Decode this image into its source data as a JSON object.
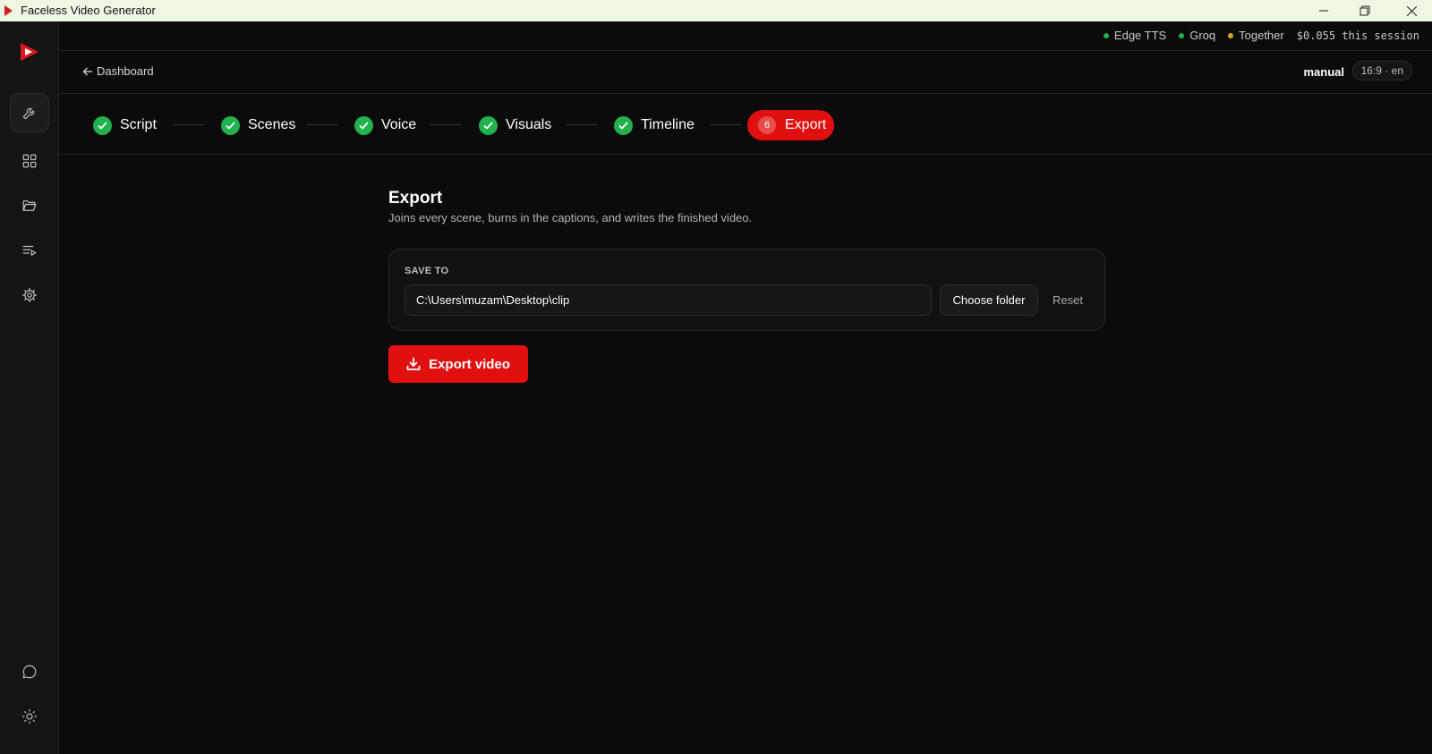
{
  "window": {
    "title": "Faceless Video Generator"
  },
  "status": {
    "providers": [
      {
        "label": "Edge TTS",
        "color": "#22b14c"
      },
      {
        "label": "Groq",
        "color": "#22b14c"
      },
      {
        "label": "Together",
        "color": "#e6a21a"
      }
    ],
    "cost": "$0.055 this session"
  },
  "header": {
    "back_label": "Dashboard",
    "mode": "manual",
    "aspect": "16:9 · en"
  },
  "stepper": {
    "steps": [
      {
        "label": "Script",
        "state": "done"
      },
      {
        "label": "Scenes",
        "state": "done"
      },
      {
        "label": "Voice",
        "state": "done"
      },
      {
        "label": "Visuals",
        "state": "done"
      },
      {
        "label": "Timeline",
        "state": "done"
      },
      {
        "label": "Export",
        "state": "active",
        "number": "6"
      }
    ]
  },
  "main": {
    "title": "Export",
    "subtitle": "Joins every scene, burns in the captions, and writes the finished video.",
    "save_to_label": "SAVE TO",
    "save_path": "C:\\Users\\muzam\\Desktop\\clip",
    "choose_folder_label": "Choose folder",
    "reset_label": "Reset",
    "export_label": "Export video"
  },
  "sidebar": {
    "items": [
      {
        "icon": "wrench-icon"
      },
      {
        "icon": "grid-icon"
      },
      {
        "icon": "folder-icon"
      },
      {
        "icon": "playlist-icon"
      },
      {
        "icon": "gear-icon"
      },
      {
        "icon": "chat-icon"
      },
      {
        "icon": "sun-icon"
      }
    ]
  },
  "colors": {
    "accent": "#e01010",
    "success": "#22b14c",
    "warning": "#e6a21a"
  }
}
